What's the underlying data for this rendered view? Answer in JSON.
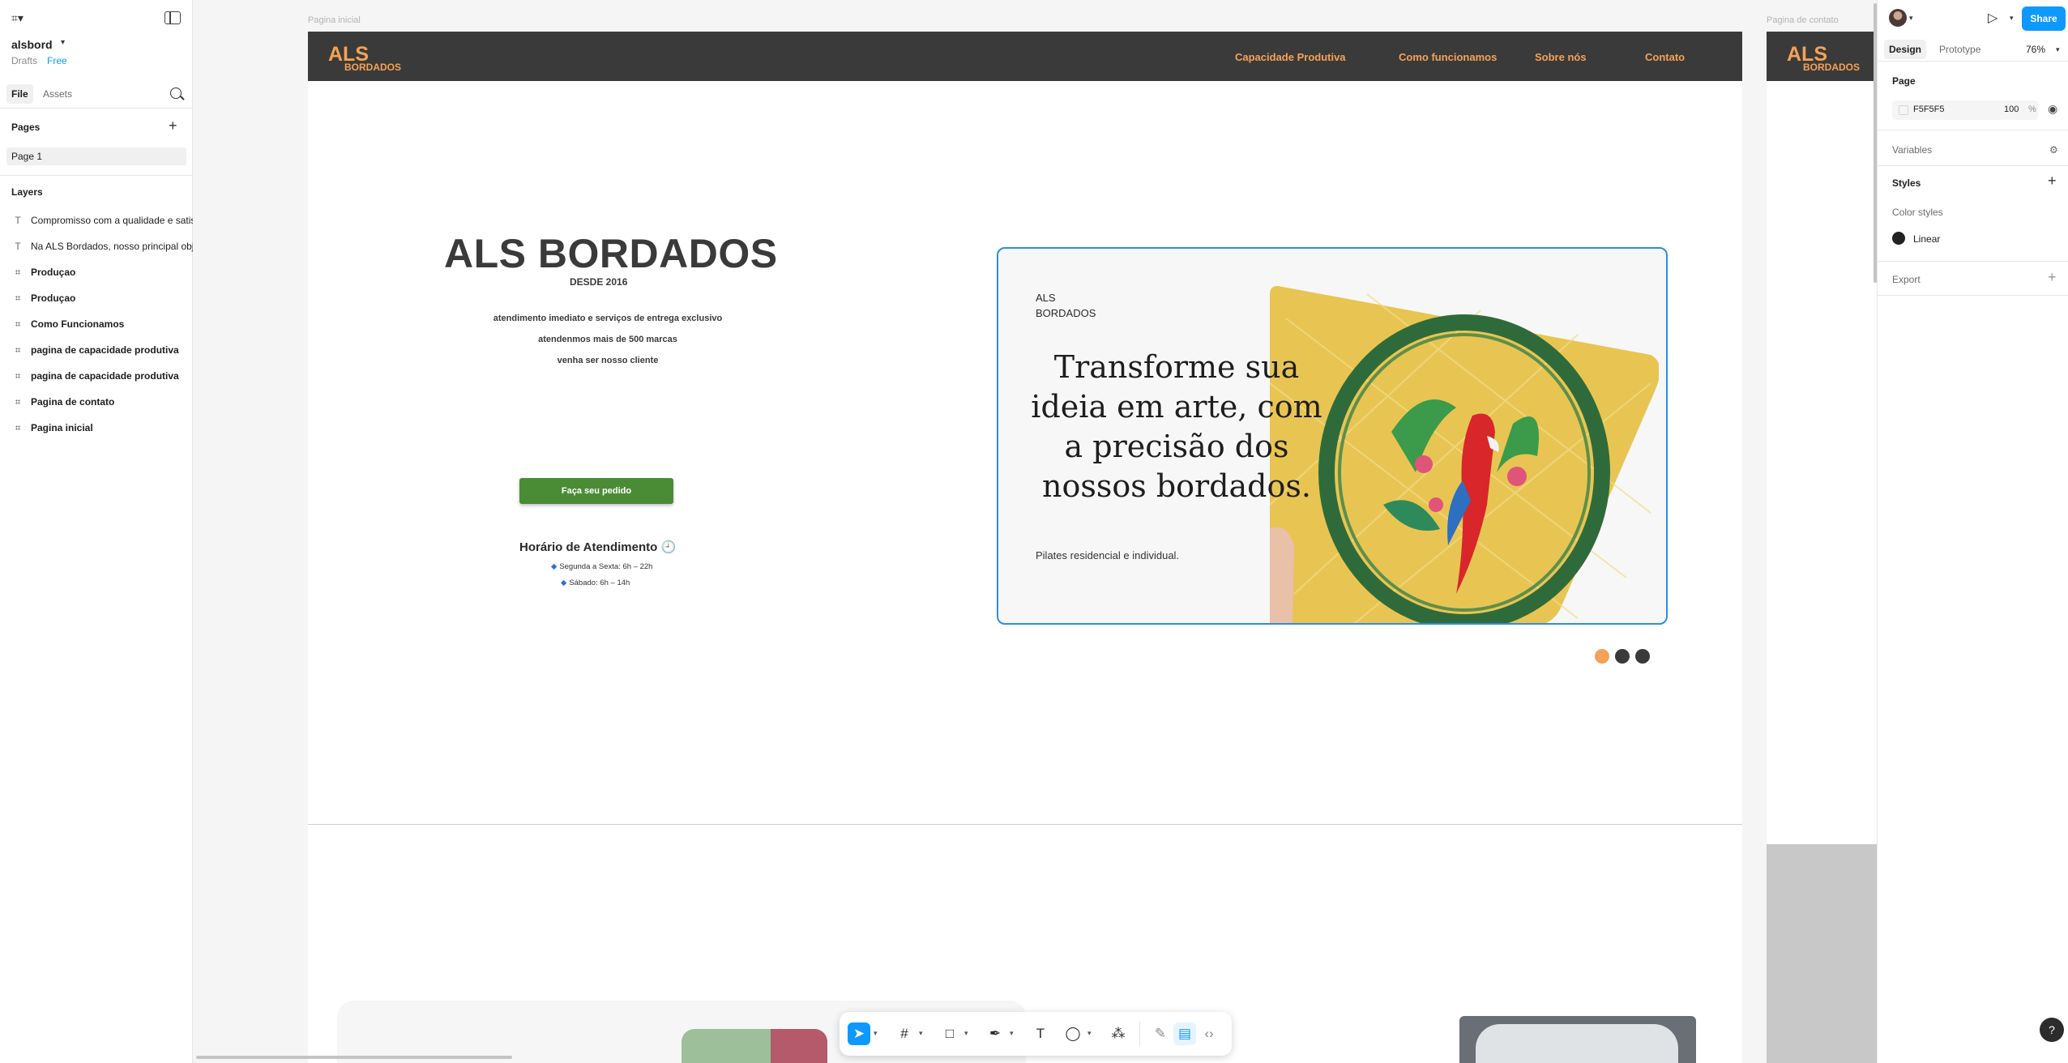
{
  "left_panel": {
    "file_name": "alsbord",
    "drafts_label": "Drafts",
    "plan_label": "Free",
    "tabs": {
      "file": "File",
      "assets": "Assets"
    },
    "pages_heading": "Pages",
    "pages": [
      "Page 1"
    ],
    "layers_heading": "Layers",
    "layers": [
      {
        "type": "text",
        "name": "Compromisso com a qualidade e satis"
      },
      {
        "type": "text",
        "name": "Na ALS Bordados, nosso principal obje"
      },
      {
        "type": "frame",
        "name": "Produçao"
      },
      {
        "type": "frame",
        "name": "Produçao"
      },
      {
        "type": "frame",
        "name": "Como Funcionamos"
      },
      {
        "type": "frame",
        "name": "pagina de capacidade produtiva"
      },
      {
        "type": "frame",
        "name": "pagina de capacidade produtiva"
      },
      {
        "type": "frame",
        "name": "Pagina de contato"
      },
      {
        "type": "frame",
        "name": "Pagina inicial"
      }
    ]
  },
  "canvas": {
    "main_frame_label": "Pagina inicial",
    "contact_frame_label": "Pagina de contato",
    "site": {
      "logo_line1": "ALS",
      "logo_line2": "BORDADOS",
      "nav": [
        "Capacidade Produtiva",
        "Como funcionamos",
        "Sobre nós",
        "Contato"
      ],
      "hero_title": "ALS BORDADOS",
      "hero_subtitle": "DESDE 2016",
      "hero_lines": [
        "atendimento imediato e serviços de entrega exclusivo",
        "atendenmos mais de 500 marcas",
        "venha ser nosso cliente"
      ],
      "cta": "Faça seu pedido",
      "hours_title": "Horário de Atendimento 🕘",
      "hours": [
        "Segunda a Sexta: 6h – 22h",
        "Sábado: 6h – 14h"
      ],
      "card": {
        "logo_line1": "ALS",
        "logo_line2": "BORDADOS",
        "headline": "Transforme sua ideia em arte, com a precisão dos nossos bordados.",
        "footer": "Pilates residencial e individual."
      },
      "carousel_dot_colors": [
        "#f3a259",
        "#3a3a3a",
        "#3a3a3a"
      ],
      "accent_color": "#f3a259",
      "cta_color": "#4a8c35"
    }
  },
  "toolbar": {
    "tools": [
      "move-tool",
      "frame-tool",
      "shape-tool",
      "pen-tool",
      "text-tool",
      "comment-tool",
      "actions-tool",
      "draw-mode",
      "design-mode",
      "dev-mode"
    ],
    "active_tool": "move-tool"
  },
  "right_panel": {
    "share_label": "Share",
    "tabs": {
      "design": "Design",
      "prototype": "Prototype"
    },
    "zoom": "76%",
    "page_heading": "Page",
    "background_hex": "F5F5F5",
    "background_opacity": "100",
    "opacity_unit": "%",
    "variables_label": "Variables",
    "styles_heading": "Styles",
    "color_styles_label": "Color styles",
    "color_style_name": "Linear",
    "export_label": "Export",
    "help_label": "?"
  }
}
